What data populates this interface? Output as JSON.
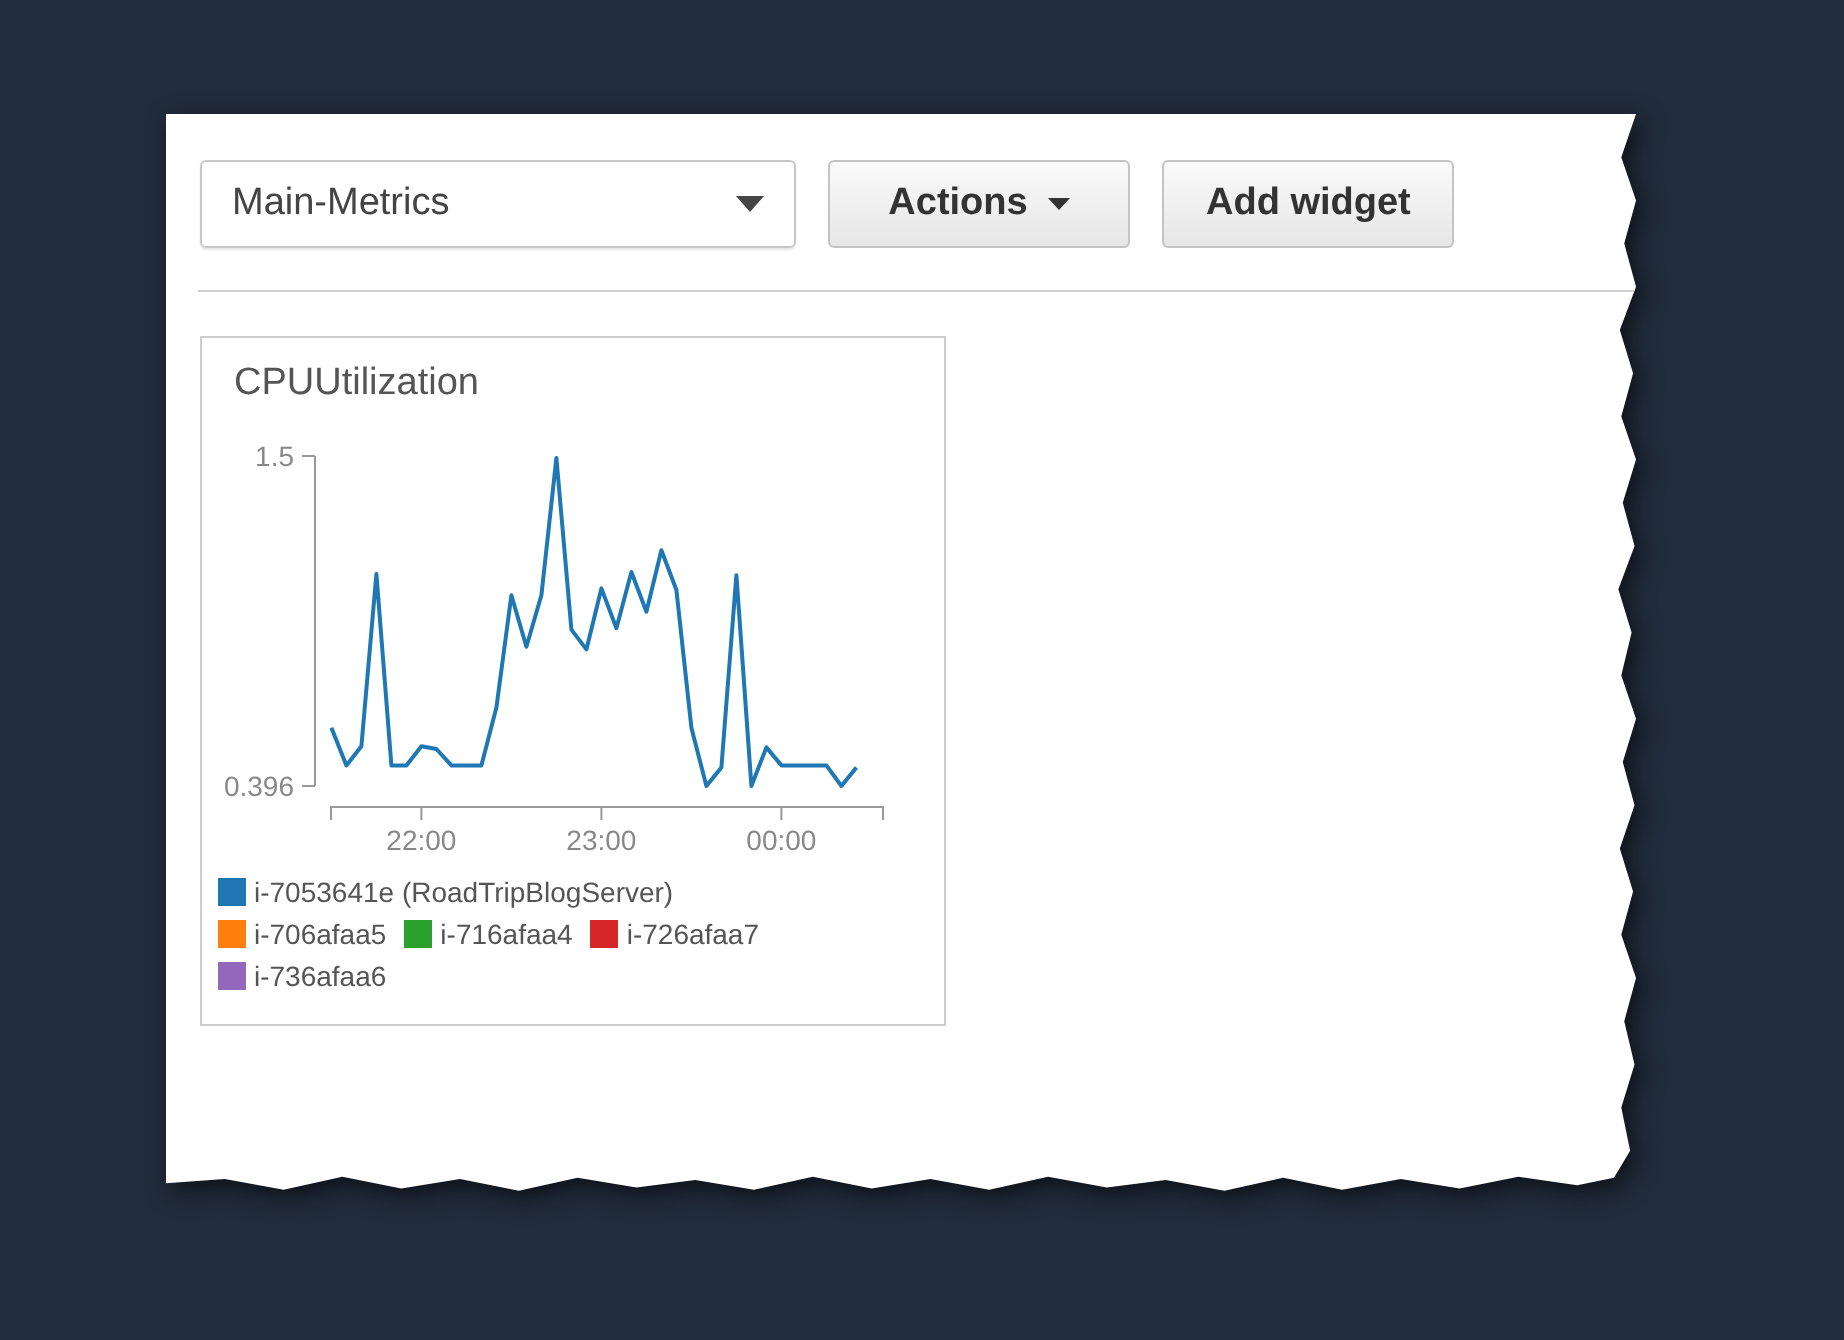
{
  "toolbar": {
    "dashboard_select": {
      "value": "Main-Metrics"
    },
    "buttons": [
      {
        "label": "Actions",
        "kind": "menu"
      },
      {
        "label": "Add widget",
        "kind": "plain"
      }
    ]
  },
  "widget": {
    "title": "CPUUtilization",
    "chart_data": {
      "type": "line",
      "categories": [
        null,
        null,
        null,
        null,
        null,
        null,
        "22:00",
        null,
        null,
        null,
        null,
        null,
        null,
        null,
        null,
        null,
        null,
        null,
        "23:00",
        null,
        null,
        null,
        null,
        null,
        null,
        null,
        null,
        null,
        null,
        null,
        "00:00",
        null,
        null,
        null,
        null,
        null
      ],
      "series": [
        {
          "name": "i-7053641e (RoadTripBlogServer)",
          "color": "#1f77b4",
          "values": [
            0.591,
            0.465,
            0.529,
            1.105,
            0.465,
            0.465,
            0.529,
            0.52,
            0.465,
            0.465,
            0.465,
            0.658,
            1.034,
            0.862,
            1.034,
            1.493,
            0.919,
            0.853,
            1.057,
            0.924,
            1.112,
            0.979,
            1.185,
            1.052,
            0.591,
            0.396,
            0.458,
            1.101,
            0.396,
            0.525,
            0.465,
            0.465,
            0.465,
            0.465,
            0.396,
            0.458
          ]
        },
        {
          "name": "i-706afaa5",
          "color": "#ff7f0e",
          "values": [
            null,
            null,
            null,
            null,
            null,
            null,
            null,
            null,
            null,
            null,
            null,
            null,
            null,
            null,
            null,
            null,
            null,
            null,
            null,
            null,
            null,
            null,
            null,
            null,
            null,
            null,
            null,
            null,
            null,
            null,
            null,
            null,
            null,
            null,
            null,
            null
          ]
        },
        {
          "name": "i-716afaa4",
          "color": "#2ca02c",
          "values": [
            null,
            null,
            null,
            null,
            null,
            null,
            null,
            null,
            null,
            null,
            null,
            null,
            null,
            null,
            null,
            null,
            null,
            null,
            null,
            null,
            null,
            null,
            null,
            null,
            null,
            null,
            null,
            null,
            null,
            null,
            null,
            null,
            null,
            null,
            null,
            null
          ]
        },
        {
          "name": "i-726afaa7",
          "color": "#d62728",
          "values": [
            null,
            null,
            null,
            null,
            null,
            null,
            null,
            null,
            null,
            null,
            null,
            null,
            null,
            null,
            null,
            null,
            null,
            null,
            null,
            null,
            null,
            null,
            null,
            null,
            null,
            null,
            null,
            null,
            null,
            null,
            null,
            null,
            null,
            null,
            null,
            null
          ]
        },
        {
          "name": "i-736afaa6",
          "color": "#9467bd",
          "values": [
            null,
            null,
            null,
            null,
            null,
            null,
            null,
            null,
            null,
            null,
            null,
            null,
            null,
            null,
            null,
            null,
            null,
            null,
            null,
            null,
            null,
            null,
            null,
            null,
            null,
            null,
            null,
            null,
            null,
            null,
            null,
            null,
            null,
            null,
            null,
            null
          ]
        }
      ],
      "ylim": [
        0.396,
        1.5
      ],
      "yticks": [
        1.5,
        0.396
      ]
    }
  }
}
